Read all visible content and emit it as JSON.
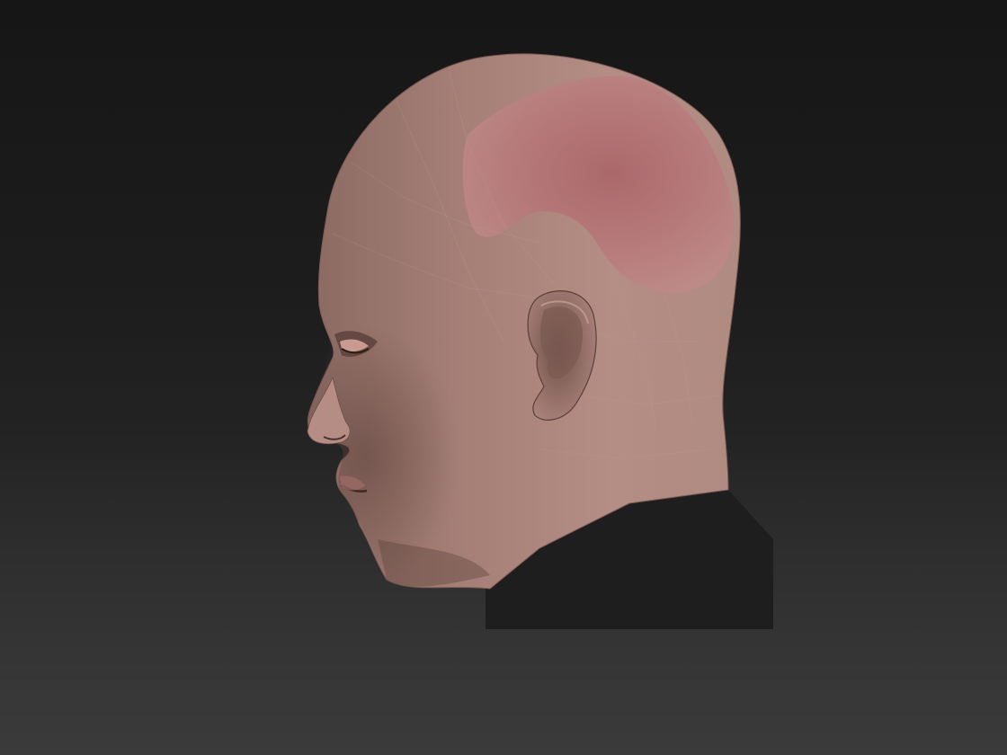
{
  "viewport": {
    "background_top": "#161616",
    "background_bottom": "#3a3a3a"
  },
  "model": {
    "icon": "head-sculpt-model",
    "skin_color": "#b58a80",
    "skin_shadow": "#6b4a44",
    "texture_patch_color": "#b96a6e",
    "shirt_color": "#1f1f1f"
  }
}
